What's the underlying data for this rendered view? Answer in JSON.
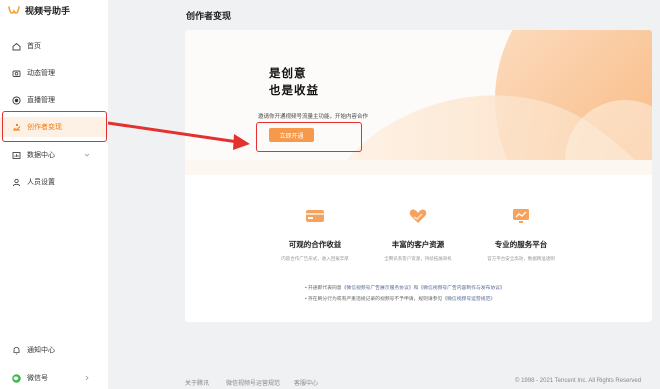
{
  "app": {
    "name": "视频号助手"
  },
  "sidebar": {
    "items": [
      {
        "label": "首页",
        "icon": "home-icon"
      },
      {
        "label": "动态管理",
        "icon": "camera-icon"
      },
      {
        "label": "直播管理",
        "icon": "live-icon"
      },
      {
        "label": "创作者变现",
        "icon": "money-icon",
        "active": true
      },
      {
        "label": "数据中心",
        "icon": "chart-icon",
        "expandable": true
      },
      {
        "label": "人员设置",
        "icon": "person-icon"
      }
    ],
    "bottom": [
      {
        "label": "通知中心",
        "icon": "bell-icon"
      },
      {
        "label": "微信号",
        "icon": "wechat-avatar-icon",
        "expandable": true
      }
    ]
  },
  "header": {
    "title": "创作者变现"
  },
  "hero": {
    "title_line1": "是创意",
    "title_line2": "也是收益",
    "subtitle": "邀请你开通视频号流量主功能，开始内容合作",
    "button_label": "立即开通"
  },
  "features": [
    {
      "title": "可观的合作收益",
      "desc": "内容合作广告形式，收入回报丰厚",
      "icon": "card-icon"
    },
    {
      "title": "丰富的客户资源",
      "desc": "全腾讯系客户资源，持续拓展商机",
      "icon": "heart-hand-icon"
    },
    {
      "title": "专业的服务平台",
      "desc": "官方平台安全高效，数据精准透明",
      "icon": "trend-icon"
    }
  ],
  "notes": {
    "line1_prefix": "• 开通即代表同意",
    "line1_link1": "《微信视频号广告展示服务协议》",
    "line1_mid": "和",
    "line1_link2": "《微信视频号广告内容制作与发布协议》",
    "line2_prefix": "• 存在刷分行为或有严重违规记录的视频号不予申请，规则请参见",
    "line2_link": "《微信视频号运营规范》"
  },
  "footer": {
    "about": "关于腾讯",
    "rules": "微信视频号运营规范",
    "service": "客服中心",
    "copyright": "© 1998 - 2021 Tencent Inc. All Rights Reserved"
  },
  "colors": {
    "accent": "#f7994a",
    "active_bg": "#fdf0e4",
    "annotation_red": "#e53030"
  }
}
